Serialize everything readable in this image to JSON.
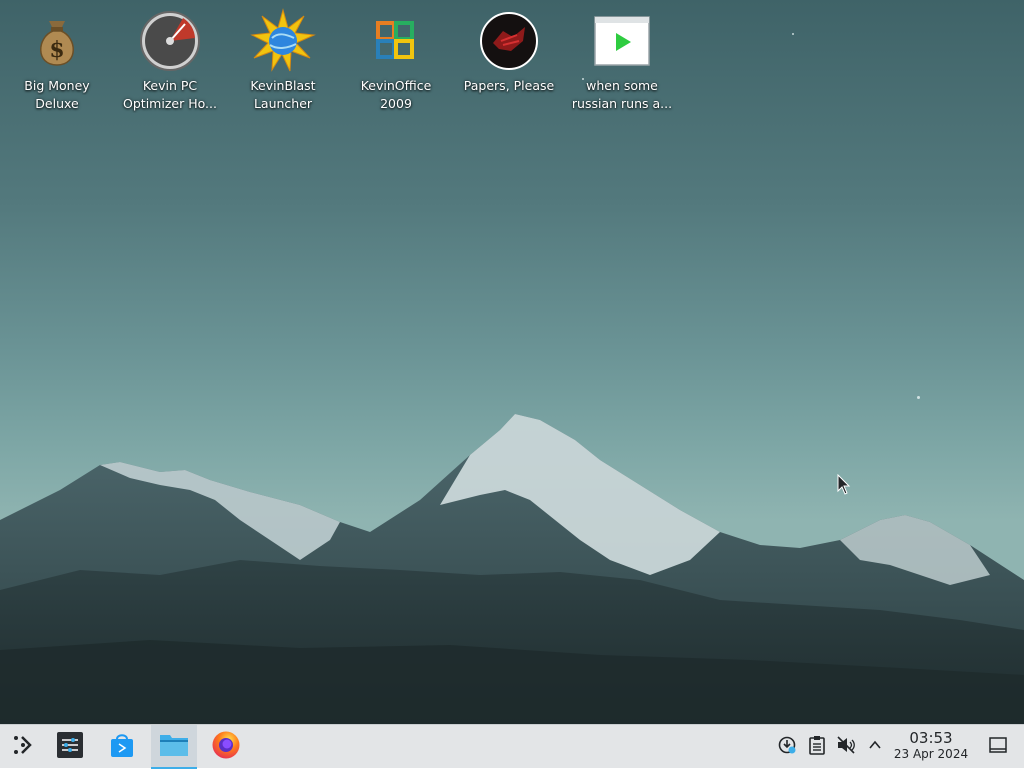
{
  "desktop": {
    "icons": [
      {
        "name": "money-bag-icon",
        "label_line1": "Big Money",
        "label_line2": "Deluxe"
      },
      {
        "name": "speedometer-icon",
        "label_line1": "Kevin PC",
        "label_line2": "Optimizer Ho..."
      },
      {
        "name": "globe-burst-icon",
        "label_line1": "KevinBlast",
        "label_line2": "Launcher"
      },
      {
        "name": "office-squares-icon",
        "label_line1": "KevinOffice",
        "label_line2": "2009"
      },
      {
        "name": "red-emblem-icon",
        "label_line1": "Papers, Please",
        "label_line2": ""
      },
      {
        "name": "video-play-icon",
        "label_line1": "when some",
        "label_line2": "russian runs a..."
      }
    ]
  },
  "taskbar": {
    "launcher_icon": "app-launcher-icon",
    "tasks": [
      {
        "name": "system-settings-icon"
      },
      {
        "name": "discover-store-icon"
      },
      {
        "name": "file-manager-icon",
        "active": true
      },
      {
        "name": "firefox-icon"
      }
    ],
    "tray": [
      {
        "name": "network-update-icon"
      },
      {
        "name": "clipboard-icon"
      },
      {
        "name": "volume-muted-icon"
      },
      {
        "name": "chevron-up-icon"
      }
    ],
    "clock": {
      "time": "03:53",
      "date": "23 Apr 2024"
    },
    "show_desktop_icon": "show-desktop-icon"
  },
  "colors": {
    "accent": "#3daee9",
    "panel": "#e3e5e7"
  }
}
